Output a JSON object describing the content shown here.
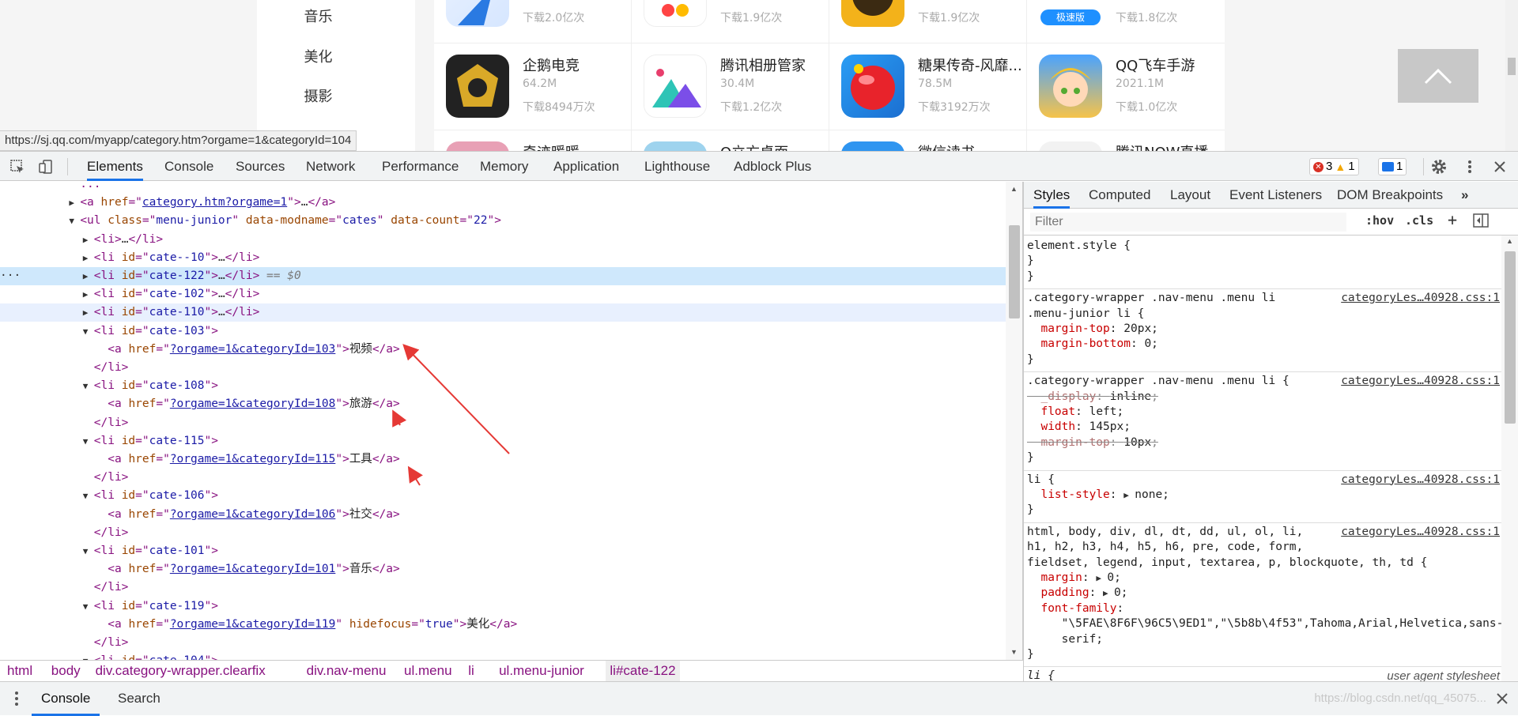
{
  "page": {
    "sidebar": [
      "音乐",
      "美化",
      "摄影"
    ],
    "apps_row_partial": [
      {
        "dl": "下载2.0亿次",
        "icon": "blue-arrow-app-icon"
      },
      {
        "dl": "下载1.9亿次",
        "icon": "colorful-app-icon"
      },
      {
        "dl": "下载1.9亿次",
        "icon": "yellow-app-icon"
      },
      {
        "dl": "下载1.8亿次",
        "icon": "speed-edition-app-icon",
        "badge": "极速版"
      }
    ],
    "apps_row": [
      {
        "name": "企鹅电竞",
        "size": "64.2M",
        "dl": "下载8494万次",
        "icon": "penguin-esports-icon"
      },
      {
        "name": "腾讯相册管家",
        "size": "30.4M",
        "dl": "下载1.2亿次",
        "icon": "photo-album-icon"
      },
      {
        "name": "糖果传奇-风靡...",
        "size": "78.5M",
        "dl": "下载3192万次",
        "icon": "candy-crush-icon"
      },
      {
        "name": "QQ飞车手游",
        "size": "2021.1M",
        "dl": "下载1.0亿次",
        "icon": "qq-speed-icon"
      }
    ],
    "apps_row_cut": [
      "奇迹暖暖",
      "Q立方桌面",
      "微信读书",
      "腾讯NOW直播"
    ],
    "status_url": "https://sj.qq.com/myapp/category.htm?orgame=1&categoryId=104"
  },
  "devtools": {
    "tabs": [
      "Elements",
      "Console",
      "Sources",
      "Network",
      "Performance",
      "Memory",
      "Application",
      "Lighthouse",
      "Adblock Plus"
    ],
    "active_tab": "Elements",
    "errors": "3",
    "warnings": "1",
    "messages": "1",
    "elements": {
      "lines": [
        {
          "indent": 0,
          "tri": "",
          "html": "  ..."
        },
        {
          "indent": 1,
          "tri": "▶",
          "tag_open": "<a ",
          "attrs": [
            {
              "n": "href",
              "v": "category.htm?orgame=1",
              "link": true
            }
          ],
          "tail": ">…</a>"
        },
        {
          "indent": 1,
          "tri": "▼",
          "tag_open": "<ul ",
          "attrs": [
            {
              "n": "class",
              "v": "menu-junior"
            },
            {
              "n": "data-modname",
              "v": "cates"
            },
            {
              "n": "data-count",
              "v": "22"
            }
          ],
          "tail": ">"
        },
        {
          "indent": 2,
          "tri": "▶",
          "tag_open": "<li",
          "attrs": [],
          "tail": ">…</li>"
        },
        {
          "indent": 2,
          "tri": "▶",
          "tag_open": "<li ",
          "attrs": [
            {
              "n": "id",
              "v": "cate--10"
            }
          ],
          "tail": ">…</li>"
        },
        {
          "indent": 2,
          "tri": "▶",
          "tag_open": "<li ",
          "attrs": [
            {
              "n": "id",
              "v": "cate-122"
            }
          ],
          "tail": ">…</li>",
          "eq": " == $0",
          "selected": true
        },
        {
          "indent": 2,
          "tri": "▶",
          "tag_open": "<li ",
          "attrs": [
            {
              "n": "id",
              "v": "cate-102"
            }
          ],
          "tail": ">…</li>"
        },
        {
          "indent": 2,
          "tri": "▶",
          "tag_open": "<li ",
          "attrs": [
            {
              "n": "id",
              "v": "cate-110"
            }
          ],
          "tail": ">…</li>",
          "hover": true
        },
        {
          "indent": 2,
          "tri": "▼",
          "tag_open": "<li ",
          "attrs": [
            {
              "n": "id",
              "v": "cate-103"
            }
          ],
          "tail": ">"
        },
        {
          "indent": 3,
          "tri": "",
          "tag_open": "<a ",
          "attrs": [
            {
              "n": "href",
              "v": "?orgame=1&categoryId=103",
              "link": true
            }
          ],
          "tail": ">",
          "text": "视频",
          "close": "</a>"
        },
        {
          "indent": 2,
          "tri": "",
          "tag_open": "</li>",
          "attrs": [],
          "tail": ""
        },
        {
          "indent": 2,
          "tri": "▼",
          "tag_open": "<li ",
          "attrs": [
            {
              "n": "id",
              "v": "cate-108"
            }
          ],
          "tail": ">"
        },
        {
          "indent": 3,
          "tri": "",
          "tag_open": "<a ",
          "attrs": [
            {
              "n": "href",
              "v": "?orgame=1&categoryId=108",
              "link": true
            }
          ],
          "tail": ">",
          "text": "旅游",
          "close": "</a>"
        },
        {
          "indent": 2,
          "tri": "",
          "tag_open": "</li>",
          "attrs": [],
          "tail": ""
        },
        {
          "indent": 2,
          "tri": "▼",
          "tag_open": "<li ",
          "attrs": [
            {
              "n": "id",
              "v": "cate-115"
            }
          ],
          "tail": ">"
        },
        {
          "indent": 3,
          "tri": "",
          "tag_open": "<a ",
          "attrs": [
            {
              "n": "href",
              "v": "?orgame=1&categoryId=115",
              "link": true
            }
          ],
          "tail": ">",
          "text": "工具",
          "close": "</a>"
        },
        {
          "indent": 2,
          "tri": "",
          "tag_open": "</li>",
          "attrs": [],
          "tail": ""
        },
        {
          "indent": 2,
          "tri": "▼",
          "tag_open": "<li ",
          "attrs": [
            {
              "n": "id",
              "v": "cate-106"
            }
          ],
          "tail": ">"
        },
        {
          "indent": 3,
          "tri": "",
          "tag_open": "<a ",
          "attrs": [
            {
              "n": "href",
              "v": "?orgame=1&categoryId=106",
              "link": true
            }
          ],
          "tail": ">",
          "text": "社交",
          "close": "</a>"
        },
        {
          "indent": 2,
          "tri": "",
          "tag_open": "</li>",
          "attrs": [],
          "tail": ""
        },
        {
          "indent": 2,
          "tri": "▼",
          "tag_open": "<li ",
          "attrs": [
            {
              "n": "id",
              "v": "cate-101"
            }
          ],
          "tail": ">"
        },
        {
          "indent": 3,
          "tri": "",
          "tag_open": "<a ",
          "attrs": [
            {
              "n": "href",
              "v": "?orgame=1&categoryId=101",
              "link": true
            }
          ],
          "tail": ">",
          "text": "音乐",
          "close": "</a>"
        },
        {
          "indent": 2,
          "tri": "",
          "tag_open": "</li>",
          "attrs": [],
          "tail": ""
        },
        {
          "indent": 2,
          "tri": "▼",
          "tag_open": "<li ",
          "attrs": [
            {
              "n": "id",
              "v": "cate-119"
            }
          ],
          "tail": ">"
        },
        {
          "indent": 3,
          "tri": "",
          "tag_open": "<a ",
          "attrs": [
            {
              "n": "href",
              "v": "?orgame=1&categoryId=119",
              "link": true
            },
            {
              "n": "hidefocus",
              "v": "true"
            }
          ],
          "tail": ">",
          "text": "美化",
          "close": "</a>"
        },
        {
          "indent": 2,
          "tri": "",
          "tag_open": "</li>",
          "attrs": [],
          "tail": ""
        },
        {
          "indent": 2,
          "tri": "▼",
          "tag_open": "<li ",
          "attrs": [
            {
              "n": "id",
              "v": "cate-104"
            }
          ],
          "tail": ">"
        }
      ]
    },
    "breadcrumb": [
      "html",
      "body",
      "div.category-wrapper.clearfix",
      "div.nav-menu",
      "ul.menu",
      "li",
      "ul.menu-junior",
      "li#cate-122"
    ],
    "styles": {
      "tabs": [
        "Styles",
        "Computed",
        "Layout",
        "Event Listeners",
        "DOM Breakpoints"
      ],
      "more": "»",
      "filter_placeholder": "Filter",
      "hov": ":hov",
      "cls": ".cls",
      "rules": [
        {
          "lines": [
            "element.style {",
            "}"
          ],
          "src": ""
        },
        {
          "lines": [
            ".category-wrapper .nav-menu .menu li",
            ".menu-junior li {"
          ],
          "src": "categoryLes…40928.css:1",
          "props": [
            {
              "n": "margin-top",
              "v": "20px"
            },
            {
              "n": "margin-bottom",
              "v": "0"
            }
          ]
        },
        {
          "lines": [
            ".category-wrapper .nav-menu .menu li {"
          ],
          "src": "categoryLes…40928.css:1",
          "props": [
            {
              "n": "_display",
              "v": "inline",
              "struck": true
            },
            {
              "n": "float",
              "v": "left"
            },
            {
              "n": "width",
              "v": "145px"
            },
            {
              "n": "margin-top",
              "v": "10px",
              "struck": true
            }
          ]
        },
        {
          "lines": [
            "li {"
          ],
          "src": "categoryLes…40928.css:1",
          "props": [
            {
              "n": "list-style",
              "v": "none",
              "tri": true
            }
          ]
        },
        {
          "lines": [
            "html, body, div, dl, dt, dd, ul, ol, li,",
            "h1, h2, h3, h4, h5, h6, pre, code, form,",
            "fieldset, legend, input, textarea, p, blockquote, th, td {"
          ],
          "src": "categoryLes…40928.css:1",
          "props": [
            {
              "n": "margin",
              "v": "0",
              "tri": true
            },
            {
              "n": "padding",
              "v": "0",
              "tri": true
            },
            {
              "n": "font-family",
              "v": ""
            }
          ],
          "extra": [
            "\"\\5FAE\\8F6F\\96C5\\9ED1\",\"\\5b8b\\4f53\",Tahoma,Arial,Helvetica,sans-",
            "serif;"
          ]
        },
        {
          "lines": [
            "li {"
          ],
          "src": "user agent stylesheet",
          "ua": true
        }
      ]
    },
    "drawer": {
      "tabs": [
        "Console",
        "Search"
      ],
      "watermark": "https://blog.csdn.net/qq_45075..."
    }
  }
}
